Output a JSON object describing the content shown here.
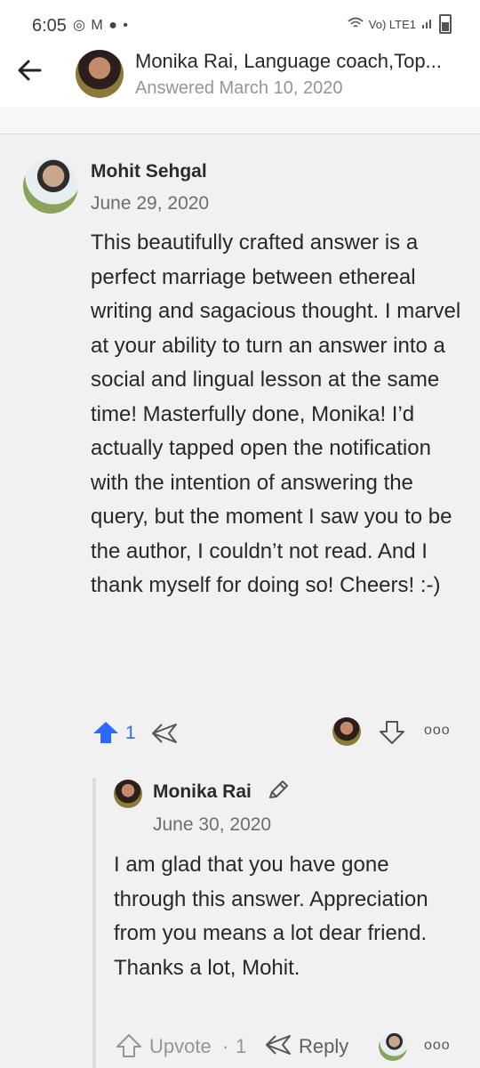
{
  "status_bar": {
    "time": "6:05",
    "notification_icons": [
      "whatsapp-icon",
      "gmail-icon",
      "phone-icon",
      "dot"
    ],
    "network_label": "Vo) LTE1"
  },
  "header": {
    "title": "Monika Rai, Language coach,Top...",
    "subtitle": "Answered March 10, 2020"
  },
  "comment": {
    "author": "Mohit Sehgal",
    "date": "June 29, 2020",
    "body": "This beautifully crafted answer is a perfect marriage between ethereal writing and sagacious thought. I marvel at your ability to turn an answer into a social and lingual lesson at the same time! Masterfully done, Monika! I’d actually tapped open the notification with the intention of answering the query, but the moment I saw you to be the author, I couldn’t not read. And I thank myself for doing so! Cheers! :-)",
    "upvote_count": "1",
    "more_label": "ooo"
  },
  "reply": {
    "author": "Monika Rai",
    "date": "June 30, 2020",
    "body": "I am glad that you have gone through this answer. Appreciation from you means a lot dear friend. Thanks a lot, Mohit.",
    "upvote_label": "Upvote",
    "separator": "·",
    "upvote_count": "1",
    "reply_label": "Reply",
    "more_label": "ooo"
  },
  "colors": {
    "accent": "#2e69ff",
    "background": "#f1f1f2",
    "muted_text": "#939598"
  }
}
